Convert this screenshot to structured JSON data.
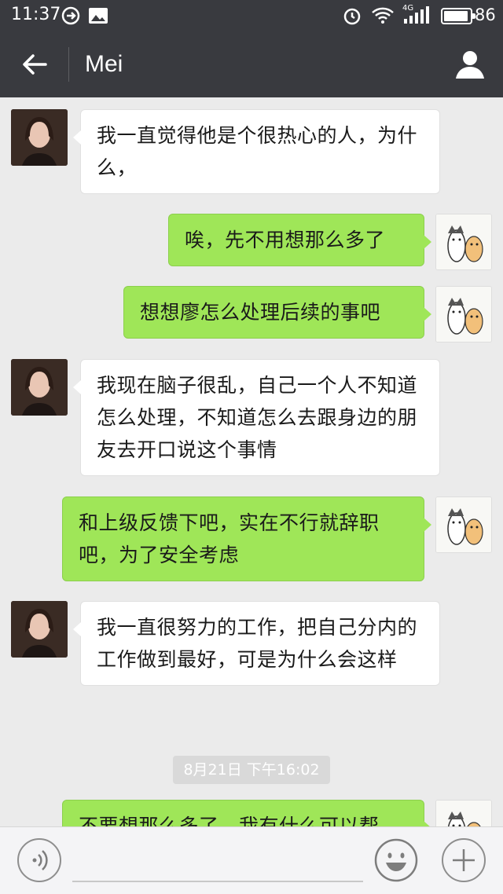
{
  "status_bar": {
    "time": "11:37",
    "battery_percent": "86",
    "network": "4G"
  },
  "header": {
    "title": "Mei",
    "back_icon": "back-arrow-icon",
    "profile_icon": "person-icon"
  },
  "messages": [
    {
      "side": "left",
      "sender": "Mei",
      "text": "我一直觉得他是个很热心的人，为什么，"
    },
    {
      "side": "right",
      "sender": "me",
      "text": "唉，先不用想那么多了"
    },
    {
      "side": "right",
      "sender": "me",
      "text": "想想廖怎么处理后续的事吧"
    },
    {
      "side": "left",
      "sender": "Mei",
      "text": "我现在脑子很乱，自己一个人不知道怎么处理，不知道怎么去跟身边的朋友去开口说这个事情"
    },
    {
      "side": "right",
      "sender": "me",
      "text": "和上级反馈下吧，实在不行就辞职吧，为了安全考虑"
    },
    {
      "side": "left",
      "sender": "Mei",
      "text": "我一直很努力的工作，把自己分内的工作做到最好，可是为什么会这样"
    },
    {
      "side": "right",
      "sender": "me",
      "text": "不要想那么多了，我有什么可以帮"
    }
  ],
  "timestamp": "8月21日 下午16:02",
  "input_bar": {
    "voice_icon": "voice-icon",
    "emoji_icon": "emoji-icon",
    "plus_icon": "plus-icon",
    "placeholder": ""
  }
}
